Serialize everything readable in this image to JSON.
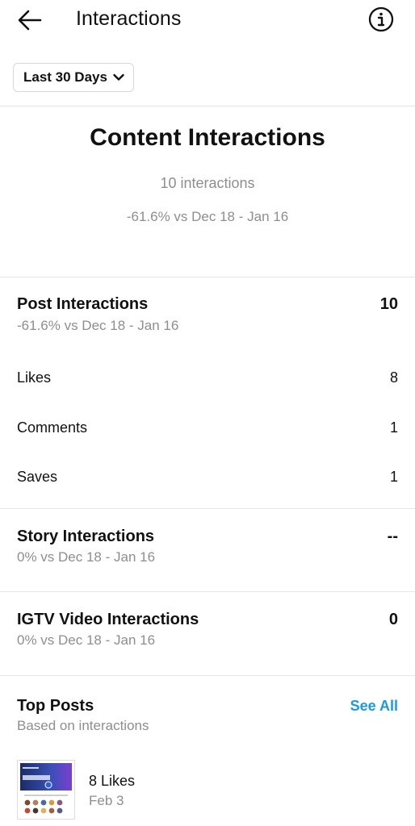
{
  "header": {
    "title": "Interactions",
    "back_icon": "arrow-left-icon",
    "info_icon": "info-circle-icon"
  },
  "range": {
    "label": "Last 30 Days",
    "icon": "chevron-down-icon"
  },
  "summary": {
    "title": "Content Interactions",
    "count": "10 interactions",
    "change": "-61.6% vs Dec 18 - Jan 16"
  },
  "post_interactions": {
    "title": "Post Interactions",
    "value": "10",
    "change": "-61.6% vs Dec 18 - Jan 16",
    "rows": [
      {
        "label": "Likes",
        "value": "8"
      },
      {
        "label": "Comments",
        "value": "1"
      },
      {
        "label": "Saves",
        "value": "1"
      }
    ]
  },
  "story_interactions": {
    "title": "Story Interactions",
    "value": "--",
    "change": "0% vs Dec 18 - Jan 16"
  },
  "igtv_interactions": {
    "title": "IGTV Video Interactions",
    "value": "0",
    "change": "0% vs Dec 18 - Jan 16"
  },
  "top_posts": {
    "title": "Top Posts",
    "subtitle": "Based on interactions",
    "see_all": "See All",
    "posts": [
      {
        "likes": "8 Likes",
        "date": "Feb 3"
      }
    ]
  },
  "colors": {
    "accent": "#1a9ae6",
    "secondary_text": "#8e8e8e",
    "divider": "#e6e6e6"
  }
}
